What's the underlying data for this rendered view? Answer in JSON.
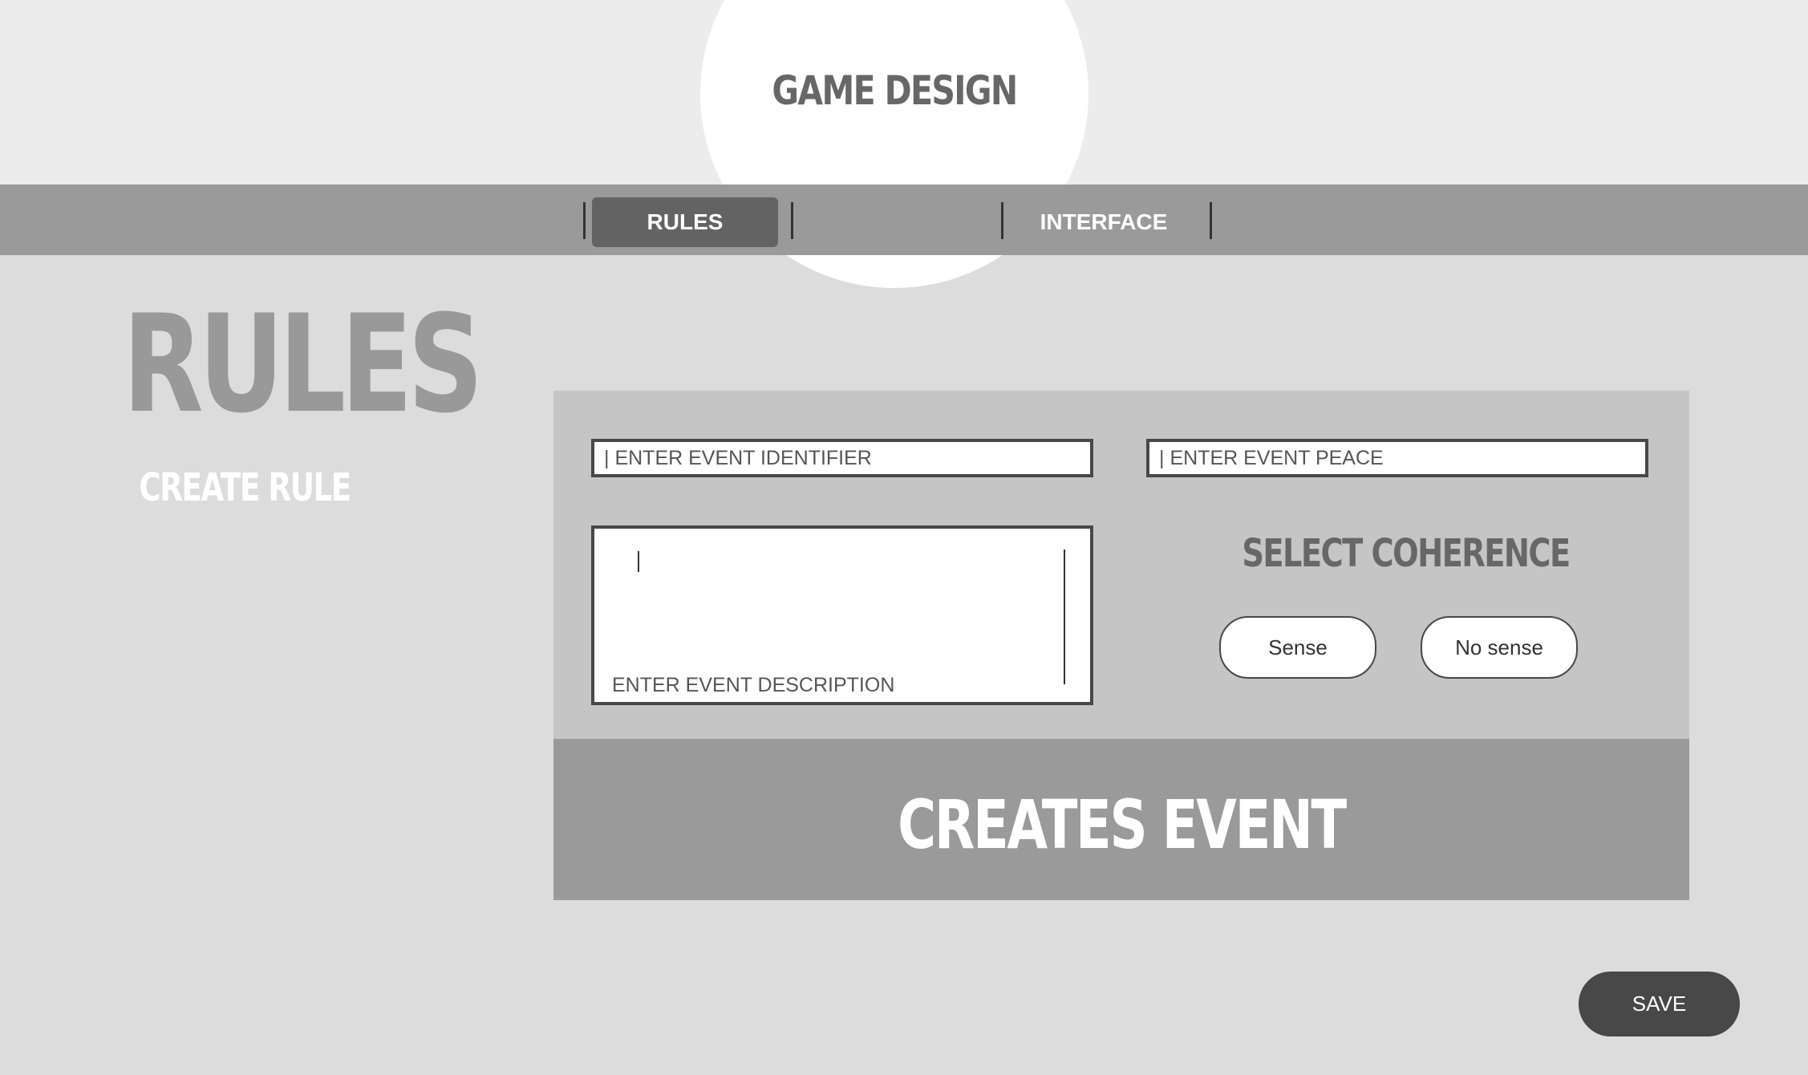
{
  "app": {
    "title": "GAME DESIGN"
  },
  "nav": {
    "tabs": [
      {
        "label": "RULES",
        "active": true
      },
      {
        "label": "",
        "active": false
      },
      {
        "label": "INTERFACE",
        "active": false
      }
    ]
  },
  "page": {
    "title": "RULES",
    "subtitle": "CREATE RULE"
  },
  "form": {
    "identifier_placeholder": "| ENTER EVENT IDENTIFIER",
    "peace_placeholder": "| ENTER EVENT PEACE",
    "description_placeholder": "ENTER EVENT DESCRIPTION",
    "coherence_title": "SELECT COHERENCE",
    "coherence_options": [
      "Sense",
      "No sense"
    ],
    "create_label": "CREATES EVENT"
  },
  "footer": {
    "save_label": "SAVE"
  },
  "colors": {
    "background": "#dcdcdc",
    "header": "#ececec",
    "tabbar": "#9a9a9a",
    "active_tab": "#636363",
    "panel": "#c5c5c5",
    "save_button": "#484848"
  }
}
